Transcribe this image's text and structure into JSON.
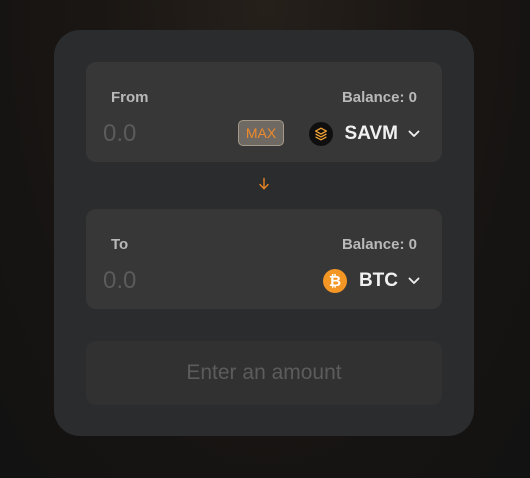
{
  "swap": {
    "from": {
      "label": "From",
      "balance": "Balance: 0",
      "amount_placeholder": "0.0",
      "amount_value": "",
      "max_label": "MAX",
      "token": {
        "symbol": "SAVM",
        "icon": "savm-token-icon"
      }
    },
    "to": {
      "label": "To",
      "balance": "Balance: 0",
      "amount_placeholder": "0.0",
      "amount_value": "",
      "token": {
        "symbol": "BTC",
        "icon": "bitcoin-icon"
      }
    },
    "switch_icon": "arrow-down-icon",
    "submit_label": "Enter an amount"
  },
  "colors": {
    "accent": "#f0892a",
    "card_background": "#2b2c2d",
    "panel_background": "#373737",
    "btc": "#f39624"
  }
}
